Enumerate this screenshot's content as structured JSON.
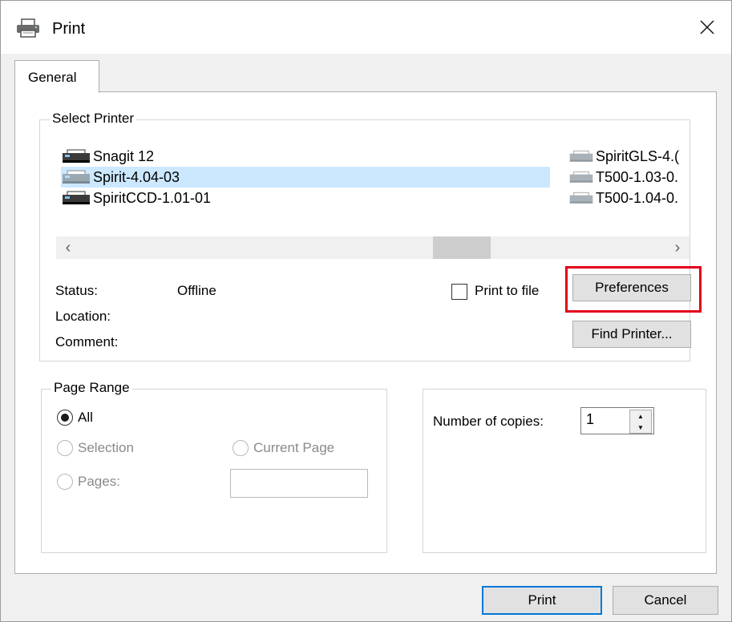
{
  "window": {
    "title": "Print"
  },
  "tabs": [
    {
      "label": "General"
    }
  ],
  "select_printer": {
    "legend": "Select Printer",
    "printers_left": [
      {
        "name": "Snagit 12",
        "selected": false
      },
      {
        "name": "Spirit-4.04-03",
        "selected": true
      },
      {
        "name": "SpiritCCD-1.01-01",
        "selected": false
      }
    ],
    "printers_right": [
      {
        "name": "SpiritGLS-4.("
      },
      {
        "name": "T500-1.03-0."
      },
      {
        "name": "T500-1.04-0."
      }
    ],
    "status_label": "Status:",
    "status_value": "Offline",
    "location_label": "Location:",
    "comment_label": "Comment:",
    "print_to_file_label": "Print to file",
    "preferences_label": "Preferences",
    "find_printer_label": "Find Printer..."
  },
  "page_range": {
    "legend": "Page Range",
    "all_label": "All",
    "selection_label": "Selection",
    "current_page_label": "Current Page",
    "pages_label": "Pages:",
    "pages_value": ""
  },
  "copies": {
    "label": "Number of copies:",
    "value": "1"
  },
  "footer": {
    "print_label": "Print",
    "cancel_label": "Cancel"
  },
  "colors": {
    "selection_bg": "#cce8ff",
    "highlight_border": "#e3001b",
    "default_button_border": "#0078d7"
  }
}
